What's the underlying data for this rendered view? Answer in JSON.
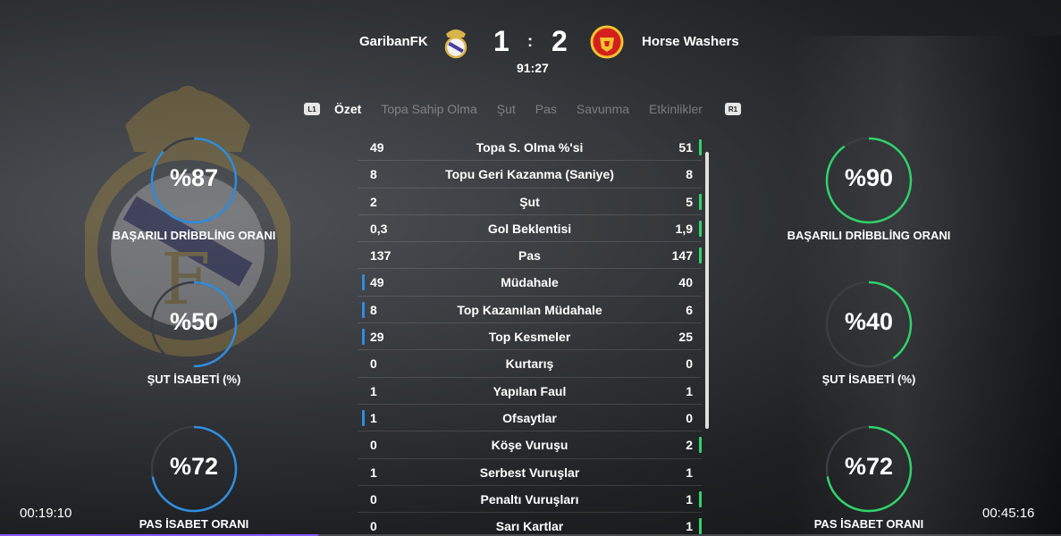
{
  "match": {
    "home_team": "GaribanFK",
    "away_team": "Horse Washers",
    "home_score": "1",
    "separator": ":",
    "away_score": "2",
    "clock": "91:27",
    "home_crest_icon": "real-madrid-crest-icon",
    "away_crest_icon": "manchester-united-crest-icon"
  },
  "tabs": {
    "left_button": "L1",
    "right_button": "R1",
    "items": [
      "Özet",
      "Topa Sahip Olma",
      "Şut",
      "Pas",
      "Savunma",
      "Etkinlikler"
    ],
    "active": "Özet"
  },
  "stats": [
    {
      "label": "Topa S. Olma %'si",
      "home": "49",
      "away": "51",
      "leader": "away"
    },
    {
      "label": "Topu Geri Kazanma (Saniye)",
      "home": "8",
      "away": "8",
      "leader": "none"
    },
    {
      "label": "Şut",
      "home": "2",
      "away": "5",
      "leader": "away"
    },
    {
      "label": "Gol Beklentisi",
      "home": "0,3",
      "away": "1,9",
      "leader": "away"
    },
    {
      "label": "Pas",
      "home": "137",
      "away": "147",
      "leader": "away"
    },
    {
      "label": "Müdahale",
      "home": "49",
      "away": "40",
      "leader": "home"
    },
    {
      "label": "Top Kazanılan Müdahale",
      "home": "8",
      "away": "6",
      "leader": "home"
    },
    {
      "label": "Top Kesmeler",
      "home": "29",
      "away": "25",
      "leader": "home"
    },
    {
      "label": "Kurtarış",
      "home": "0",
      "away": "0",
      "leader": "none"
    },
    {
      "label": "Yapılan Faul",
      "home": "1",
      "away": "1",
      "leader": "none"
    },
    {
      "label": "Ofsaytlar",
      "home": "1",
      "away": "0",
      "leader": "home"
    },
    {
      "label": "Köşe Vuruşu",
      "home": "0",
      "away": "2",
      "leader": "away"
    },
    {
      "label": "Serbest Vuruşlar",
      "home": "1",
      "away": "1",
      "leader": "none"
    },
    {
      "label": "Penaltı Vuruşları",
      "home": "0",
      "away": "1",
      "leader": "away"
    },
    {
      "label": "Sarı Kartlar",
      "home": "0",
      "away": "1",
      "leader": "away"
    }
  ],
  "home_gauges": [
    {
      "value": "%87",
      "percent": 87,
      "label": "BAŞARILI DRİBBLİNG ORANI"
    },
    {
      "value": "%50",
      "percent": 50,
      "label": "ŞUT İSABETİ (%)"
    },
    {
      "value": "%72",
      "percent": 72,
      "label": "PAS İSABET ORANI"
    }
  ],
  "away_gauges": [
    {
      "value": "%90",
      "percent": 90,
      "label": "BAŞARILI DRİBBLİNG ORANI"
    },
    {
      "value": "%40",
      "percent": 40,
      "label": "ŞUT İSABETİ (%)"
    },
    {
      "value": "%72",
      "percent": 72,
      "label": "PAS İSABET ORANI"
    }
  ],
  "colors": {
    "home_accent": "#2f8ee0",
    "away_accent": "#2fd36a",
    "track": "#3a3d42"
  },
  "player": {
    "elapsed": "00:19:10",
    "remaining": "00:45:16",
    "progress_fraction": 0.3
  }
}
